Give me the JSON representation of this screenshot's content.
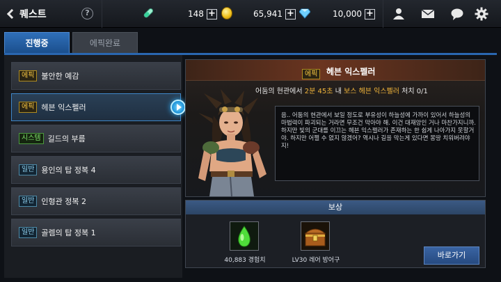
{
  "header": {
    "title": "퀘스트",
    "help_icon": "?",
    "stamina": {
      "value": "148",
      "icon": "stamina-vial-icon"
    },
    "gold": {
      "value": "65,941",
      "icon": "gold-coin-icon"
    },
    "gems": {
      "value": "10,000",
      "icon": "blue-gem-icon"
    },
    "plus_label": "+",
    "icons": [
      "friends-icon",
      "mail-icon",
      "chat-icon",
      "settings-gear-icon"
    ]
  },
  "tabs": [
    {
      "label": "진행중",
      "active": true
    },
    {
      "label": "에픽완료",
      "active": false
    }
  ],
  "quests": [
    {
      "tag": "에픽",
      "tag_type": "epic",
      "name": "불안한 예감"
    },
    {
      "tag": "에픽",
      "tag_type": "epic",
      "name": "헤븐 익스펠러",
      "selected": true
    },
    {
      "tag": "시스템",
      "tag_type": "system",
      "name": "길드의 부름"
    },
    {
      "tag": "일반",
      "tag_type": "normal",
      "name": "용인의 탑 정복 4"
    },
    {
      "tag": "일반",
      "tag_type": "normal",
      "name": "인형관 정복 2"
    },
    {
      "tag": "일반",
      "tag_type": "normal",
      "name": "골렘의 탑 정복 1"
    }
  ],
  "detail": {
    "tag": "에픽",
    "title": "헤븐 익스펠러",
    "objective_prefix": "어둠의 현관에서 ",
    "objective_time": "2분 45초",
    "objective_mid": " 내 ",
    "objective_boss": "보스 헤븐 익스펠러",
    "objective_suffix": " 처치 0/1",
    "dialog": "음.. 어둠의 현관에서 보일 정도로 부유성이 하늘성에 가까이 있어서 하늘성의 마법력이 파괴되는 거라면 무조건 막아야 해. 이건 대재앙인 거나 마찬가지니까. 하지만 빛의 군대를 이끄는 헤븐 익스펠러가 존재하는 한 쉽게 나아가지 못할거야. 하지만 어쩔 수 없지 않겠어? 역시나 길을 막는게 있다면 몽땅 치워버려야지!"
  },
  "reward": {
    "header": "보상",
    "items": [
      {
        "label": "40,883 경험치",
        "icon": "green-exp-potion-icon"
      },
      {
        "label": "LV30 레어 방어구",
        "icon": "treasure-chest-icon"
      }
    ],
    "go_button": "바로가기"
  },
  "colors": {
    "accent_blue": "#2a67b0",
    "epic_gold": "#f0c040",
    "system_green": "#7ee06b",
    "normal_cyan": "#8fd0ee",
    "objective_highlight": "#f0b43a"
  }
}
